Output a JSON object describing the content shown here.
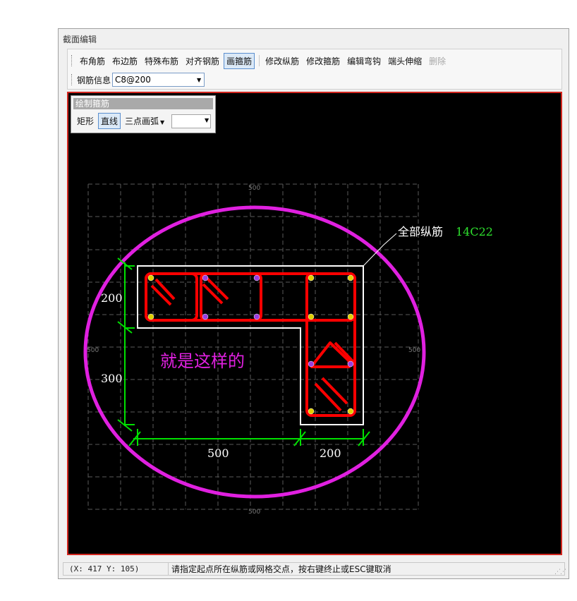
{
  "window": {
    "title": "截面编辑"
  },
  "toolbar": {
    "buttons": [
      {
        "label": "布角筋",
        "state": "normal"
      },
      {
        "label": "布边筋",
        "state": "normal"
      },
      {
        "label": "特殊布筋",
        "state": "normal"
      },
      {
        "label": "对齐钢筋",
        "state": "normal"
      },
      {
        "label": "画箍筋",
        "state": "active"
      },
      {
        "label": "修改纵筋",
        "state": "normal"
      },
      {
        "label": "修改箍筋",
        "state": "normal"
      },
      {
        "label": "编辑弯钩",
        "state": "normal"
      },
      {
        "label": "端头伸缩",
        "state": "normal"
      },
      {
        "label": "删除",
        "state": "disabled"
      }
    ],
    "rebar_info_label": "钢筋信息",
    "rebar_info_value": "C8@200"
  },
  "draw_panel": {
    "title": "绘制箍筋",
    "rect_label": "矩形",
    "line_label": "直线",
    "arc_label": "三点画弧",
    "combo_value": ""
  },
  "drawing": {
    "annotation_label": "全部纵筋",
    "annotation_value": "14C22",
    "note": "就是这样的",
    "dim_v1": "200",
    "dim_v2": "300",
    "dim_h1": "500",
    "dim_h2": "200",
    "grid_top": "500",
    "grid_bottom": "500",
    "grid_left": "500",
    "grid_right": "500"
  },
  "status": {
    "coords": "(X: 417 Y: 105)",
    "message": "请指定起点所在纵筋或网格交点，按右键终止或ESC键取消"
  },
  "colors": {
    "rebar": "#ff0000",
    "dimension": "#00e000",
    "circle": "#e020e0",
    "outline": "#ffffff",
    "canvas_bg": "#000000"
  }
}
